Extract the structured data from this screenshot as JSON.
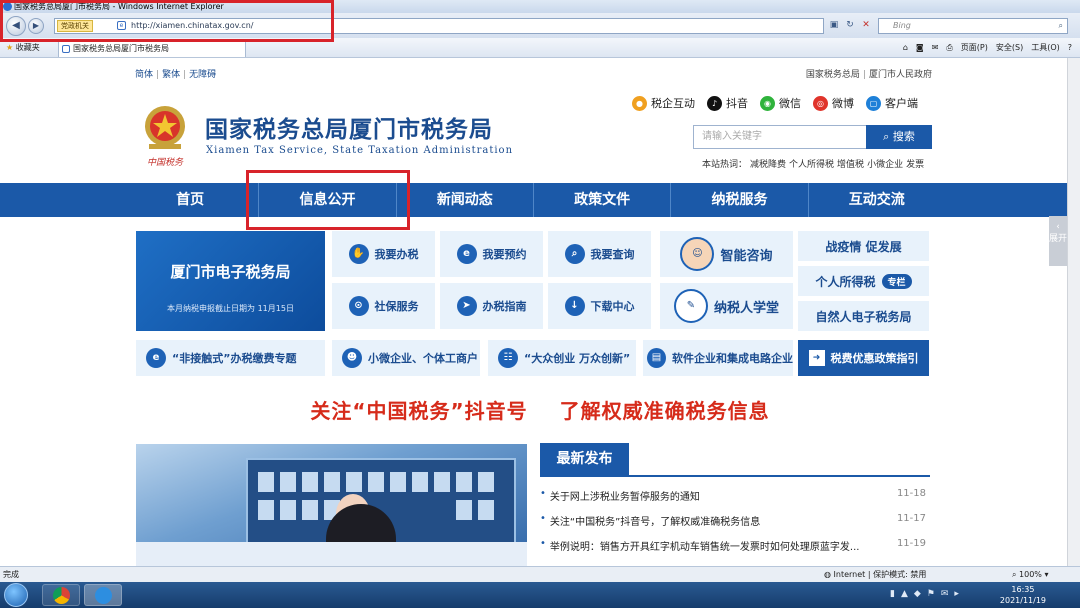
{
  "window": {
    "title": "国家税务总局厦门市税务局 - Windows Internet Explorer"
  },
  "addressbar": {
    "tag": "党政机关",
    "url": "http://xiamen.chinatax.gov.cn/",
    "search_placeholder": "Bing"
  },
  "favorites": {
    "label": "收藏夹",
    "tab_title": "国家税务总局厦门市税务局"
  },
  "toolbar": {
    "page": "页面(P)",
    "safety": "安全(S)",
    "tools": "工具(O)"
  },
  "toplinks": {
    "left": [
      "简体",
      "繁体",
      "无障碍"
    ],
    "right": [
      "国家税务总局",
      "厦门市人民政府"
    ]
  },
  "header": {
    "name": "国家税务总局厦门市税务局",
    "name_en": "Xiamen Tax Service, State Taxation Administration",
    "emblem_text": "中国税务"
  },
  "social": [
    "税企互动",
    "抖音",
    "微信",
    "微博",
    "客户端"
  ],
  "search": {
    "placeholder": "请输入关键字",
    "button": "搜索",
    "hot_label": "本站热词：",
    "hot_words": [
      "减税降费",
      "个人所得税",
      "增值税",
      "小微企业",
      "发票"
    ]
  },
  "nav": [
    "首页",
    "信息公开",
    "新闻动态",
    "政策文件",
    "纳税服务",
    "互动交流"
  ],
  "etax": {
    "title": "厦门市电子税务局",
    "note": "本月纳税申报截止日期为 11月15日"
  },
  "services": {
    "row1": [
      "我要办税",
      "我要预约",
      "我要查询"
    ],
    "row2": [
      "社保服务",
      "办税指南",
      "下载中心"
    ],
    "smart": "智能咨询",
    "learn": "纳税人学堂",
    "right": [
      "战疫情 促发展",
      "个人所得税",
      "自然人电子税务局"
    ],
    "right_badge": "专栏",
    "bottom": [
      "“非接触式”办税缴费专题",
      "小微企业、个体工商户",
      "“大众创业 万众创新”",
      "软件企业和集成电路企业"
    ],
    "policy": "税费优惠政策指引"
  },
  "banner": [
    "关注“中国税务”抖音号",
    "了解权威准确税务信息"
  ],
  "news": {
    "title": "最新发布",
    "items": [
      {
        "text": "关于网上涉税业务暂停服务的通知",
        "date": "11-18"
      },
      {
        "text": "关注“中国税务”抖音号，了解权威准确税务信息",
        "date": "11-17"
      },
      {
        "text": "举例说明：销售方开具红字机动车销售统一发票时如何处理原蓝字发...",
        "date": "11-19"
      }
    ]
  },
  "side_tab": "展开",
  "statusbar": {
    "left": "完成",
    "zone": "Internet | 保护模式: 禁用",
    "zoom": "100%"
  },
  "taskbar": {
    "time": "16:35",
    "date": "2021/11/19"
  }
}
